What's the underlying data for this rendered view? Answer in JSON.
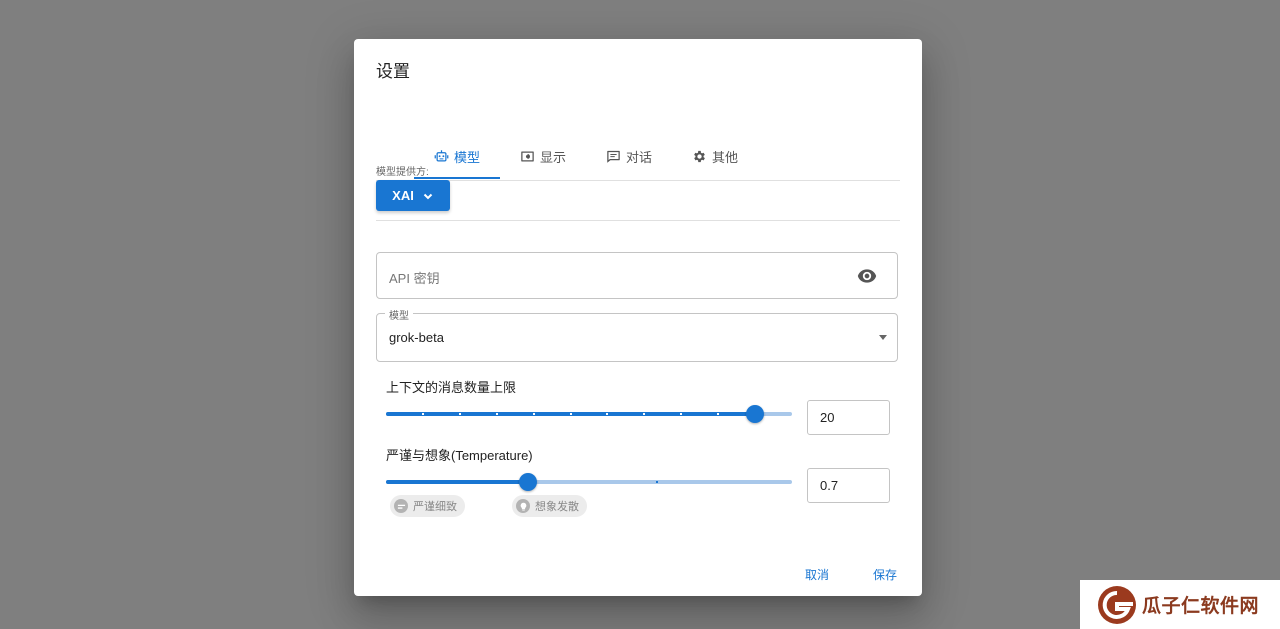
{
  "dialog": {
    "title": "设置",
    "tabs": [
      {
        "label": "模型",
        "icon": "robot-icon",
        "active": true
      },
      {
        "label": "显示",
        "icon": "display-icon",
        "active": false
      },
      {
        "label": "对话",
        "icon": "chat-icon",
        "active": false
      },
      {
        "label": "其他",
        "icon": "gear-icon",
        "active": false
      }
    ],
    "provider": {
      "label": "模型提供方:",
      "value": "XAI"
    },
    "api_key": {
      "placeholder": "API 密钥"
    },
    "model": {
      "legend": "模型",
      "value": "grok-beta"
    },
    "context_limit": {
      "label": "上下文的消息数量上限",
      "value": "20",
      "fraction": 0.91
    },
    "temperature": {
      "label": "严谨与想象(Temperature)",
      "value": "0.7",
      "fraction": 0.35,
      "chips": {
        "strict": "严谨细致",
        "imaginative": "想象发散"
      }
    },
    "actions": {
      "cancel": "取消",
      "save": "保存"
    }
  },
  "watermark": {
    "text": "瓜子仁软件网"
  },
  "colors": {
    "accent": "#1976d2",
    "overlay": "#7f7f7f",
    "watermark": "#8b3a1f"
  }
}
